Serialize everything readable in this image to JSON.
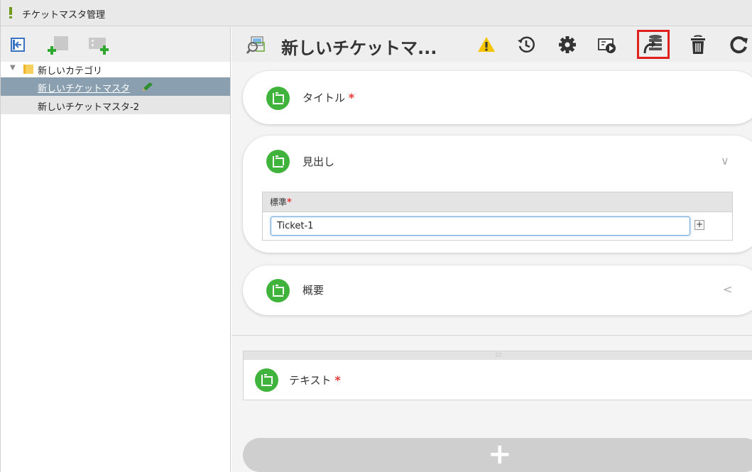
{
  "window": {
    "title": "チケットマスタ管理"
  },
  "sidebar": {
    "toolbar": {
      "icons": [
        "collapse-panel-icon",
        "add-category-icon",
        "add-ticket-master-icon"
      ]
    },
    "category": {
      "label": "新しいカテゴリ",
      "icon": "folder-icon"
    },
    "items": [
      {
        "label": "新しいチケットマスタ",
        "selected": true,
        "icon": "pencil-icon"
      },
      {
        "label": "新しいチケットマスタ-2",
        "selected": false
      }
    ]
  },
  "header": {
    "title": "新しいチケットマ...",
    "icons": [
      "ticket-master-icon",
      "warning-icon",
      "history-icon",
      "settings-icon",
      "preview-icon",
      "export-database-icon",
      "trash-icon",
      "refresh-icon"
    ],
    "highlighted": "export-database-icon",
    "accent_color": "#e0201c"
  },
  "form": {
    "title_field": {
      "label": "タイトル",
      "required": "*"
    },
    "heading_field": {
      "label": "見出し",
      "table_header": "標準",
      "required": "*",
      "value": "Ticket-1",
      "add_label": "+"
    },
    "summary_field": {
      "label": "概要"
    },
    "text_field": {
      "label": "テキスト",
      "required": "*",
      "drag_handle": ":::"
    },
    "add_button": "+"
  },
  "colors": {
    "green": "#3fb33b",
    "selected_row": "#8aa0b0",
    "warning": "#f5c400"
  }
}
